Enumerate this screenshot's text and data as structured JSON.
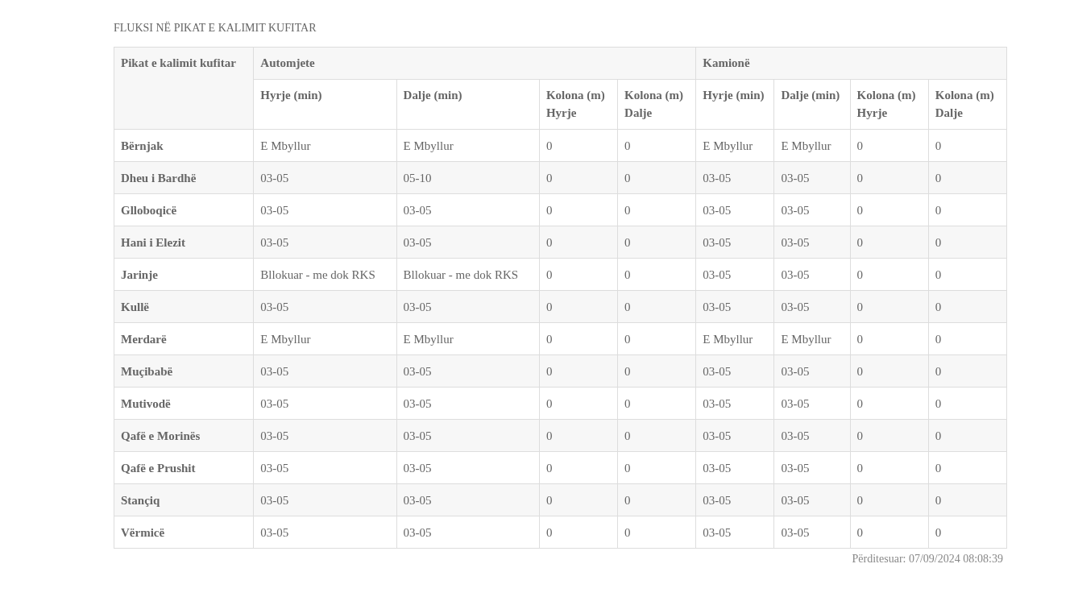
{
  "title": "FLUKSI NË PIKAT E KALIMIT KUFITAR",
  "table": {
    "corner": "Pikat e kalimit kufitar",
    "groups": [
      {
        "label": "Automjete",
        "columns": [
          "Hyrje (min)",
          "Dalje (min)",
          "Kolona (m) Hyrje",
          "Kolona (m) Dalje"
        ]
      },
      {
        "label": "Kamionë",
        "columns": [
          "Hyrje (min)",
          "Dalje (min)",
          "Kolona (m) Hyrje",
          "Kolona (m) Dalje"
        ]
      }
    ],
    "rows": [
      {
        "name": "Bërnjak",
        "cells": [
          "E Mbyllur",
          "E Mbyllur",
          "0",
          "0",
          "E Mbyllur",
          "E Mbyllur",
          "0",
          "0"
        ]
      },
      {
        "name": "Dheu i Bardhë",
        "cells": [
          "03-05",
          "05-10",
          "0",
          "0",
          "03-05",
          "03-05",
          "0",
          "0"
        ]
      },
      {
        "name": "Glloboqicë",
        "cells": [
          "03-05",
          "03-05",
          "0",
          "0",
          "03-05",
          "03-05",
          "0",
          "0"
        ]
      },
      {
        "name": "Hani i Elezit",
        "cells": [
          "03-05",
          "03-05",
          "0",
          "0",
          "03-05",
          "03-05",
          "0",
          "0"
        ]
      },
      {
        "name": "Jarinje",
        "cells": [
          "Bllokuar - me dok RKS",
          "Bllokuar - me dok RKS",
          "0",
          "0",
          "03-05",
          "03-05",
          "0",
          "0"
        ]
      },
      {
        "name": "Kullë",
        "cells": [
          "03-05",
          "03-05",
          "0",
          "0",
          "03-05",
          "03-05",
          "0",
          "0"
        ]
      },
      {
        "name": "Merdarë",
        "cells": [
          "E Mbyllur",
          "E Mbyllur",
          "0",
          "0",
          "E Mbyllur",
          "E Mbyllur",
          "0",
          "0"
        ]
      },
      {
        "name": "Muçibabë",
        "cells": [
          "03-05",
          "03-05",
          "0",
          "0",
          "03-05",
          "03-05",
          "0",
          "0"
        ]
      },
      {
        "name": "Mutivodë",
        "cells": [
          "03-05",
          "03-05",
          "0",
          "0",
          "03-05",
          "03-05",
          "0",
          "0"
        ]
      },
      {
        "name": "Qafë e Morinës",
        "cells": [
          "03-05",
          "03-05",
          "0",
          "0",
          "03-05",
          "03-05",
          "0",
          "0"
        ]
      },
      {
        "name": "Qafë e Prushit",
        "cells": [
          "03-05",
          "03-05",
          "0",
          "0",
          "03-05",
          "03-05",
          "0",
          "0"
        ]
      },
      {
        "name": "Stançiq",
        "cells": [
          "03-05",
          "03-05",
          "0",
          "0",
          "03-05",
          "03-05",
          "0",
          "0"
        ]
      },
      {
        "name": "Vërmicë",
        "cells": [
          "03-05",
          "03-05",
          "0",
          "0",
          "03-05",
          "03-05",
          "0",
          "0"
        ]
      }
    ]
  },
  "updated": "Përditesuar: 07/09/2024 08:08:39"
}
